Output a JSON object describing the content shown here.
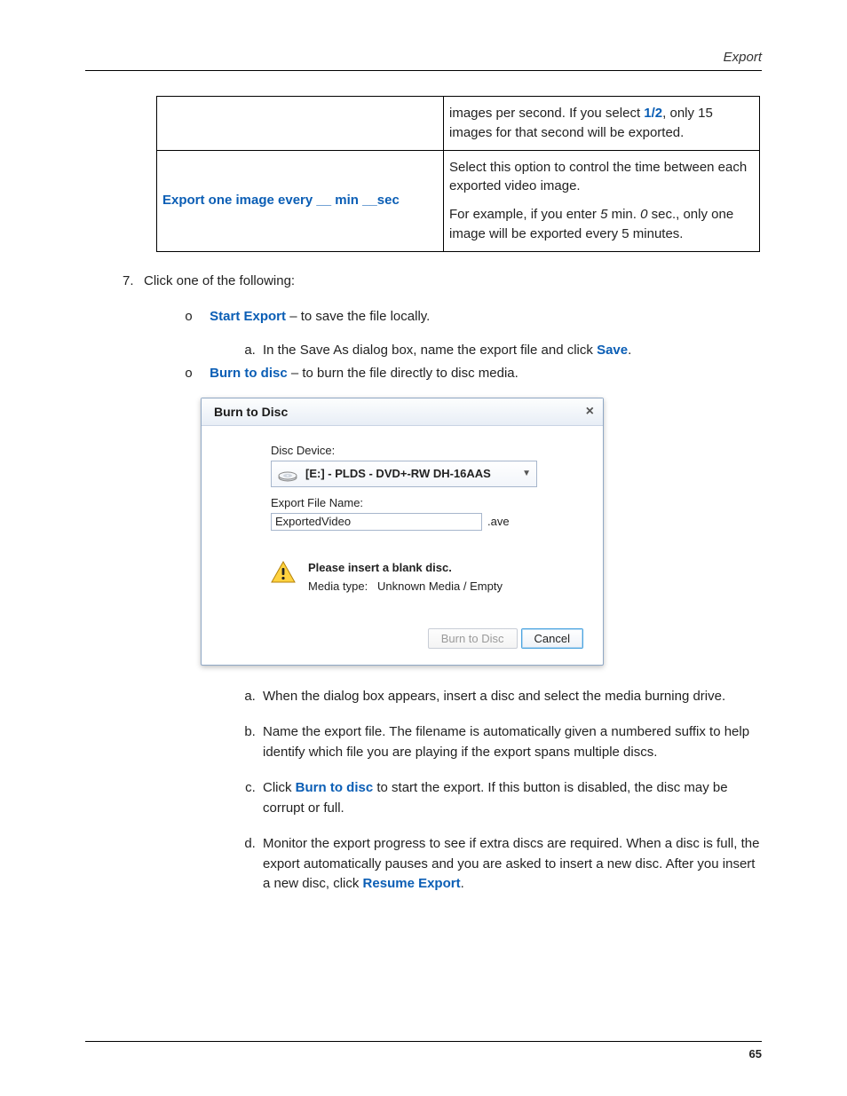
{
  "header": {
    "title": "Export"
  },
  "table": {
    "row1": {
      "desc_cont": "images per second. If you select ",
      "half": "1/2",
      "desc_cont2": ", only 15 images for that second will be exported."
    },
    "row2": {
      "label": "Export one image every __ min __sec",
      "desc1": "Select this option to control the time between each exported video image.",
      "desc2_pre": "For example, if you enter ",
      "five": "5",
      "desc2_mid": " min. ",
      "zero": "0",
      "desc2_post": " sec., only one image will be exported every 5 minutes."
    }
  },
  "steps": {
    "num7": "7.",
    "click_text": "Click one of the following:",
    "start_export": "Start Export",
    "start_export_rest": " – to save the file locally.",
    "step_a_pre": "In the Save As dialog box, name the export file and click ",
    "save_word": "Save",
    "burn_to_disc": "Burn to disc",
    "burn_to_disc_rest": " – to burn the file directly to disc media."
  },
  "dialog": {
    "title": "Burn to Disc",
    "close": "×",
    "disc_device_label": "Disc Device:",
    "disc_device_value": "[E:] - PLDS - DVD+-RW DH-16AAS",
    "export_file_label": "Export File Name:",
    "export_file_value": "ExportedVideo",
    "ext": ".ave",
    "warn_msg": "Please insert a blank disc.",
    "media_type_label": "Media type:",
    "media_type_value": "Unknown Media / Empty",
    "btn_burn": "Burn to Disc",
    "btn_cancel": "Cancel"
  },
  "substeps": {
    "a": "When the dialog box appears, insert a disc and select the media burning drive.",
    "b": "Name the export file. The filename is automatically given a numbered suffix to help identify which file you are playing if the export spans multiple discs.",
    "c_pre": "Click ",
    "c_bold": "Burn to disc",
    "c_post": " to start the export. If this button is disabled, the disc may be corrupt or full.",
    "d_pre": "Monitor the export progress to see if extra discs are required. When a disc is full, the export automatically pauses and you are asked to insert a new disc. After you insert a new disc, click ",
    "d_bold": "Resume Export",
    "d_post": "."
  },
  "footer": {
    "page": "65"
  }
}
